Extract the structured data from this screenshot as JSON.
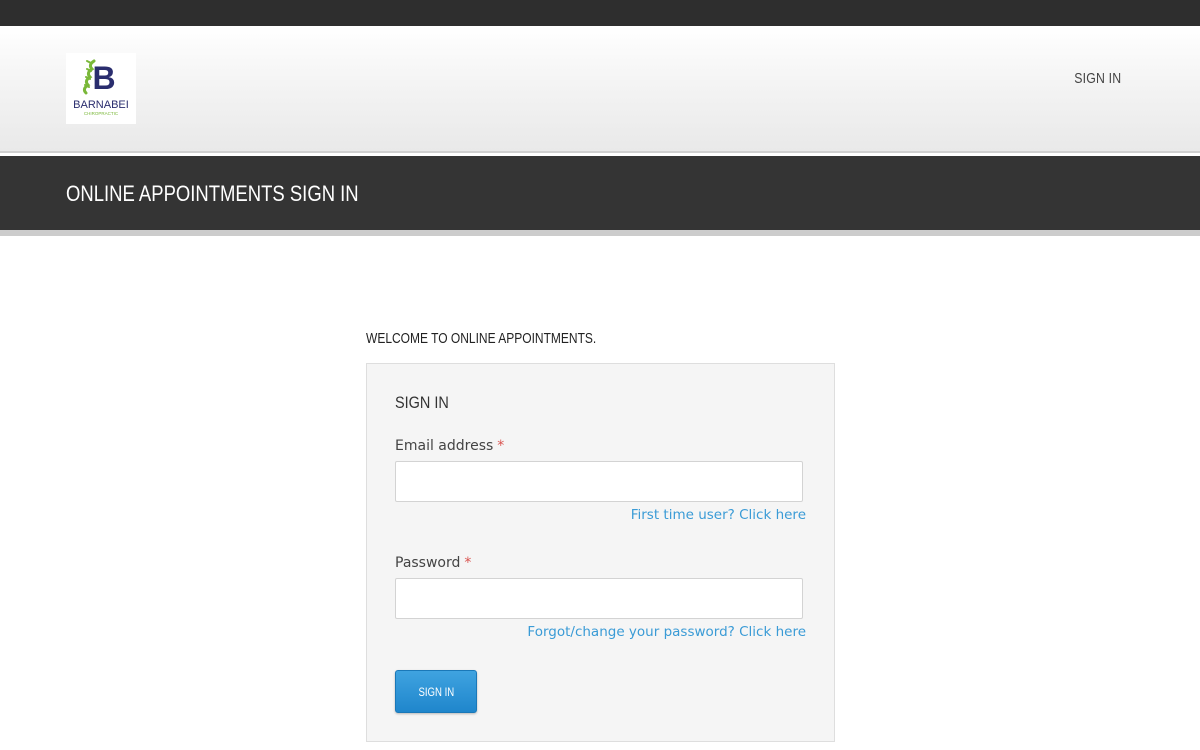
{
  "brand": {
    "logo_letter": "B",
    "name": "BARNABEI",
    "tagline": "CHIROPRACTIC",
    "accent_color": "#7ab839",
    "letter_color": "#2a2d6e"
  },
  "nav": {
    "sign_in_label": "SIGN IN"
  },
  "page": {
    "title": "ONLINE APPOINTMENTS SIGN IN",
    "welcome": "WELCOME TO ONLINE APPOINTMENTS."
  },
  "form": {
    "heading": "SIGN IN",
    "email": {
      "label": "Email address",
      "required_mark": "*",
      "value": "",
      "placeholder": ""
    },
    "first_time_link": "First time user? Click here",
    "password": {
      "label": "Password",
      "required_mark": "*",
      "value": "",
      "placeholder": ""
    },
    "forgot_link": "Forgot/change your password? Click here",
    "submit_label": "SIGN IN"
  },
  "colors": {
    "topbar": "#2e2e2e",
    "title_band": "#343434",
    "link": "#3a9bd6",
    "button": "#2a93d5",
    "required": "#d9534f"
  }
}
